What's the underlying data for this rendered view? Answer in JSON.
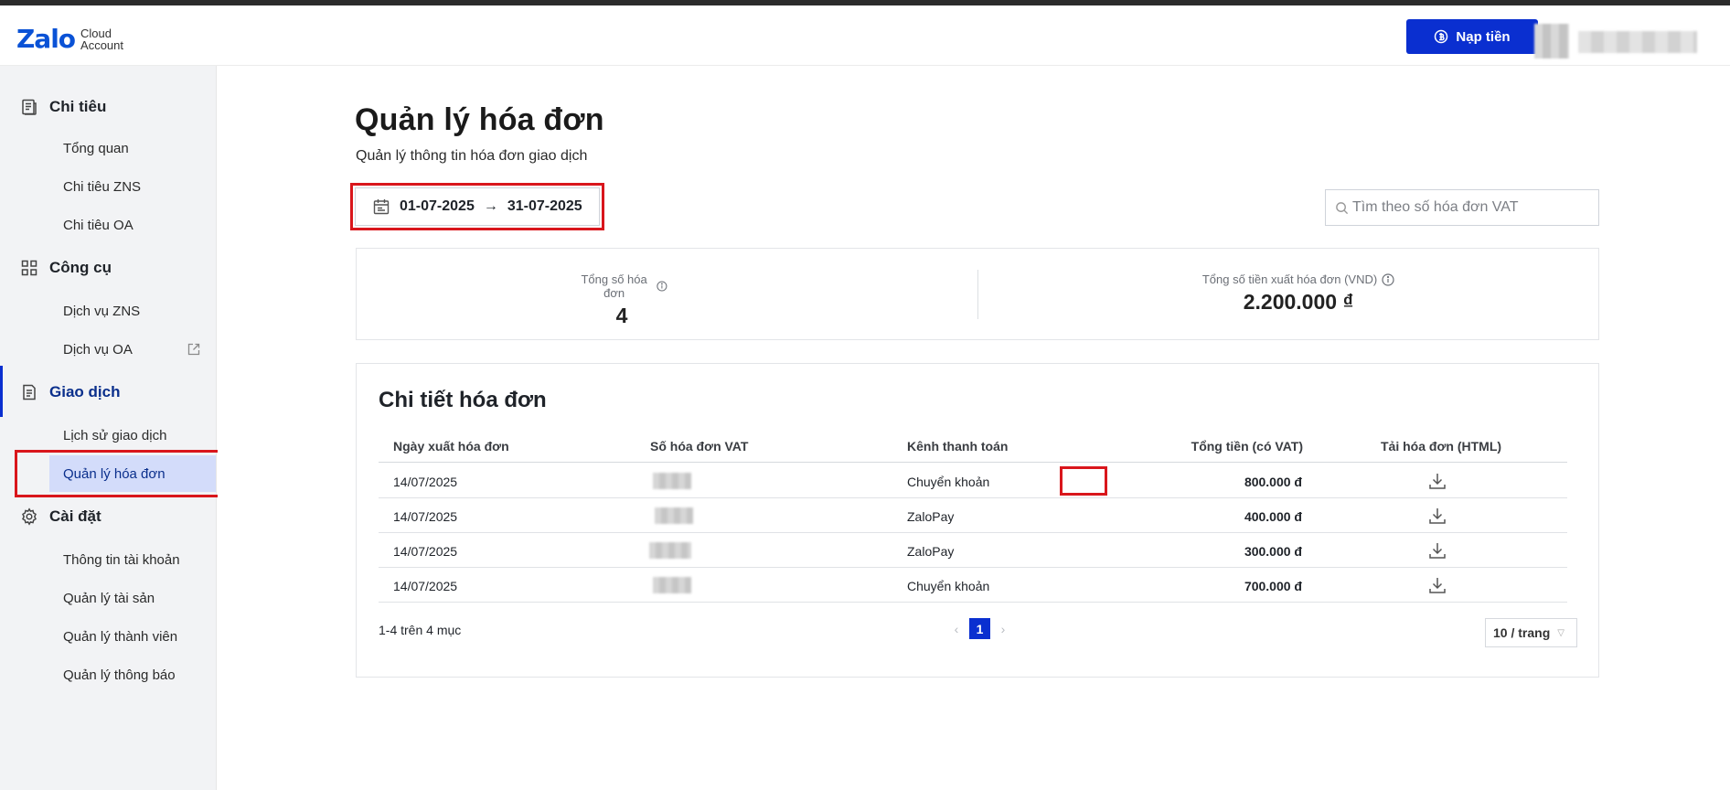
{
  "header": {
    "logo_mark": "Zalo",
    "logo_sub_1": "Cloud",
    "logo_sub_2": "Account",
    "topup_label": "Nạp tiền"
  },
  "sidebar": {
    "sections": [
      {
        "label": "Chi tiêu",
        "icon": "receipt-icon",
        "items": [
          "Tổng quan",
          "Chi tiêu ZNS",
          "Chi tiêu OA"
        ]
      },
      {
        "label": "Công cụ",
        "icon": "grid-icon",
        "items": [
          "Dịch vụ ZNS",
          "Dịch vụ OA"
        ]
      },
      {
        "label": "Giao dịch",
        "icon": "document-icon",
        "items": [
          "Lịch sử giao dịch",
          "Quản lý hóa đơn"
        ]
      },
      {
        "label": "Cài đặt",
        "icon": "gear-icon",
        "items": [
          "Thông tin tài khoản",
          "Quản lý tài sản",
          "Quản lý thành viên",
          "Quản lý thông báo"
        ]
      }
    ],
    "active_section": "Giao dịch",
    "selected_item": "Quản lý hóa đơn"
  },
  "page": {
    "title": "Quản lý hóa đơn",
    "subtitle": "Quản lý thông tin hóa đơn giao dịch",
    "date_from": "01-07-2025",
    "date_arrow": "→",
    "date_to": "31-07-2025",
    "search_placeholder": "Tìm theo số hóa đơn VAT"
  },
  "summary": {
    "total_invoices_label": "Tổng số hóa đơn",
    "total_invoices_value": "4",
    "total_amount_label": "Tổng số tiền xuất hóa đơn (VND)",
    "total_amount_value": "2.200.000 ₫"
  },
  "details": {
    "title": "Chi tiết hóa đơn",
    "columns": [
      "Ngày xuất hóa đơn",
      "Số hóa đơn VAT",
      "Kênh thanh toán",
      "Tổng tiền (có VAT)",
      "Tải hóa đơn (HTML)"
    ],
    "rows": [
      {
        "date": "14/07/2025",
        "channel": "Chuyển khoản",
        "amount": "800.000 đ"
      },
      {
        "date": "14/07/2025",
        "channel": "ZaloPay",
        "amount": "400.000 đ"
      },
      {
        "date": "14/07/2025",
        "channel": "ZaloPay",
        "amount": "300.000 đ"
      },
      {
        "date": "14/07/2025",
        "channel": "Chuyển khoản",
        "amount": "700.000 đ"
      }
    ],
    "pager_info": "1-4 trên 4 mục",
    "current_page": "1",
    "page_size": "10 / trang"
  },
  "colors": {
    "accent": "#0a2fd0",
    "highlight": "#d9161c",
    "selected_bg": "#d3dcfa"
  }
}
